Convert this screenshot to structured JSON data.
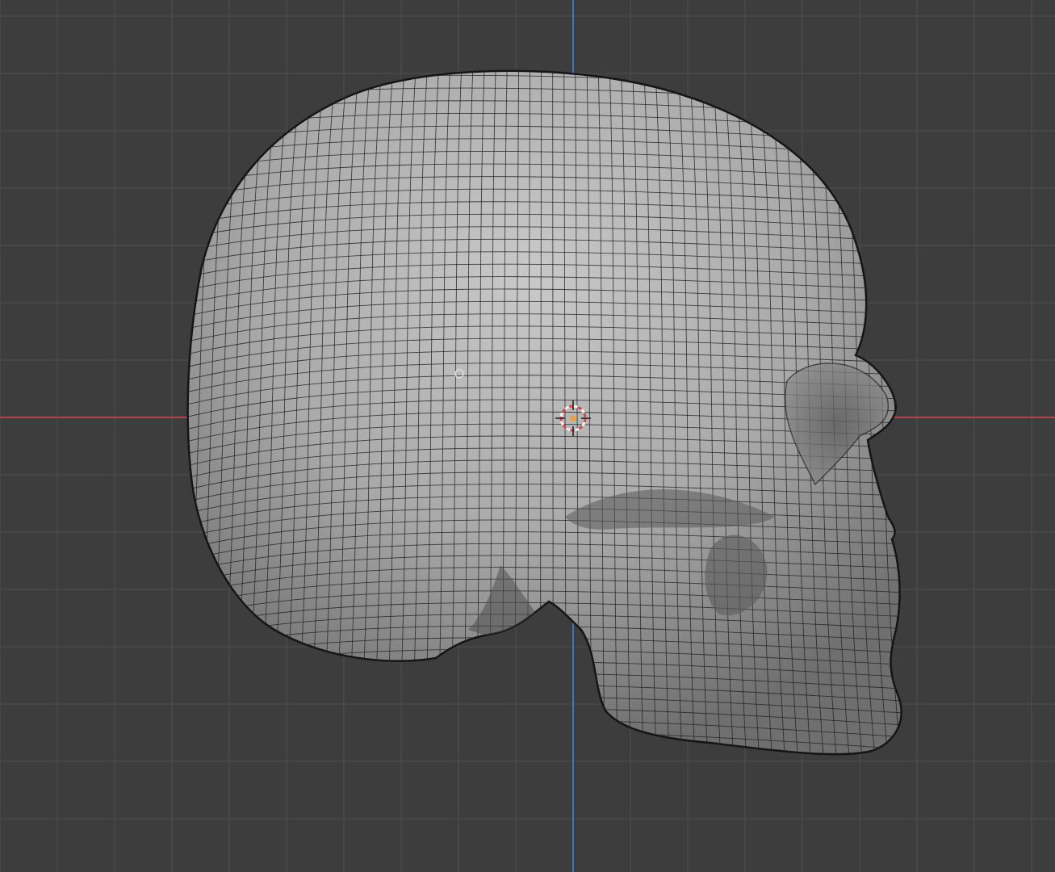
{
  "viewport": {
    "type": "3d-viewport",
    "view": "right-orthographic",
    "shading": "solid",
    "overlay": "wireframe",
    "object": "skull-mesh"
  },
  "colors": {
    "background": "#3d3d3d",
    "grid_line": "#4f4f4f",
    "x_axis": "#b5434f",
    "z_axis": "#3f75b0",
    "mesh_fill_light": "#c4c4c4",
    "mesh_fill_dark": "#6b6b6b",
    "wire": "#202020",
    "cursor_ring_red": "#d94848",
    "cursor_ring_white": "#f2f2f2",
    "origin_dot": "#f0a030"
  },
  "icons": {
    "cursor": "3d-cursor-icon",
    "origin": "object-origin-icon",
    "pivot": "pivot-point-icon"
  }
}
